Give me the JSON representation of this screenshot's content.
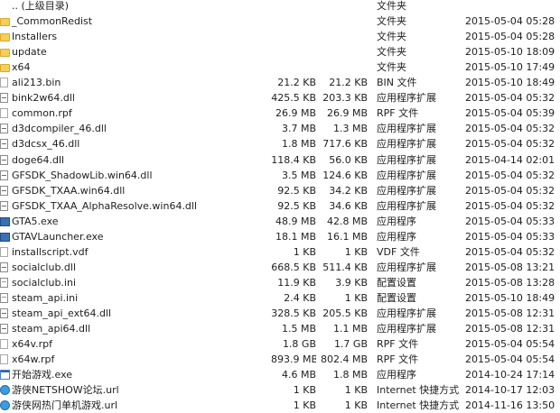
{
  "rows": [
    {
      "icon": "parent-folder-icon",
      "name": ".. (上级目录)",
      "size": "",
      "packed": "",
      "type": "文件夹",
      "modified": ""
    },
    {
      "icon": "folder-icon",
      "name": "_CommonRedist",
      "size": "",
      "packed": "",
      "type": "文件夹",
      "modified": "2015-05-04 05:28"
    },
    {
      "icon": "folder-icon",
      "name": "Installers",
      "size": "",
      "packed": "",
      "type": "文件夹",
      "modified": "2015-05-04 05:28"
    },
    {
      "icon": "folder-icon",
      "name": "update",
      "size": "",
      "packed": "",
      "type": "文件夹",
      "modified": "2015-05-10 18:09"
    },
    {
      "icon": "folder-icon",
      "name": "x64",
      "size": "",
      "packed": "",
      "type": "文件夹",
      "modified": "2015-05-10 17:49"
    },
    {
      "icon": "file-icon",
      "name": "ali213.bin",
      "size": "21.2 KB",
      "packed": "21.2 KB",
      "type": "BIN 文件",
      "modified": "2015-05-10 18:49"
    },
    {
      "icon": "dll-file-icon",
      "name": "bink2w64.dll",
      "size": "425.5 KB",
      "packed": "203.3 KB",
      "type": "应用程序扩展",
      "modified": "2015-05-04 05:32"
    },
    {
      "icon": "file-icon",
      "name": "common.rpf",
      "size": "26.9 MB",
      "packed": "26.9 MB",
      "type": "RPF 文件",
      "modified": "2015-05-04 05:39"
    },
    {
      "icon": "dll-file-icon",
      "name": "d3dcompiler_46.dll",
      "size": "3.7 MB",
      "packed": "1.3 MB",
      "type": "应用程序扩展",
      "modified": "2015-05-04 05:32"
    },
    {
      "icon": "dll-file-icon",
      "name": "d3dcsx_46.dll",
      "size": "1.8 MB",
      "packed": "717.6 KB",
      "type": "应用程序扩展",
      "modified": "2015-05-04 05:32"
    },
    {
      "icon": "dll-file-icon",
      "name": "doge64.dll",
      "size": "118.4 KB",
      "packed": "56.0 KB",
      "type": "应用程序扩展",
      "modified": "2015-04-14 02:01"
    },
    {
      "icon": "dll-file-icon",
      "name": "GFSDK_ShadowLib.win64.dll",
      "size": "3.5 MB",
      "packed": "124.6 KB",
      "type": "应用程序扩展",
      "modified": "2015-05-04 05:32"
    },
    {
      "icon": "dll-file-icon",
      "name": "GFSDK_TXAA.win64.dll",
      "size": "92.5 KB",
      "packed": "34.2 KB",
      "type": "应用程序扩展",
      "modified": "2015-05-04 05:32"
    },
    {
      "icon": "dll-file-icon",
      "name": "GFSDK_TXAA_AlphaResolve.win64.dll",
      "size": "92.5 KB",
      "packed": "34.6 KB",
      "type": "应用程序扩展",
      "modified": "2015-05-04 05:32"
    },
    {
      "icon": "exe-icon",
      "name": "GTA5.exe",
      "size": "48.9 MB",
      "packed": "42.8 MB",
      "type": "应用程序",
      "modified": "2015-05-04 05:33"
    },
    {
      "icon": "exe-icon",
      "name": "GTAVLauncher.exe",
      "size": "18.1 MB",
      "packed": "16.1 MB",
      "type": "应用程序",
      "modified": "2015-05-04 05:33"
    },
    {
      "icon": "file-icon",
      "name": "installscript.vdf",
      "size": "1 KB",
      "packed": "1 KB",
      "type": "VDF 文件",
      "modified": "2015-05-04 05:32"
    },
    {
      "icon": "dll-file-icon",
      "name": "socialclub.dll",
      "size": "668.5 KB",
      "packed": "511.4 KB",
      "type": "应用程序扩展",
      "modified": "2015-05-08 13:21"
    },
    {
      "icon": "ini-file-icon",
      "name": "socialclub.ini",
      "size": "11.9 KB",
      "packed": "3.9 KB",
      "type": "配置设置",
      "modified": "2015-05-08 13:28"
    },
    {
      "icon": "ini-file-icon",
      "name": "steam_api.ini",
      "size": "2.4 KB",
      "packed": "1 KB",
      "type": "配置设置",
      "modified": "2015-05-10 18:49"
    },
    {
      "icon": "dll-file-icon",
      "name": "steam_api_ext64.dll",
      "size": "328.5 KB",
      "packed": "205.5 KB",
      "type": "应用程序扩展",
      "modified": "2015-05-08 12:31"
    },
    {
      "icon": "dll-file-icon",
      "name": "steam_api64.dll",
      "size": "1.5 MB",
      "packed": "1.1 MB",
      "type": "应用程序扩展",
      "modified": "2015-05-08 12:31"
    },
    {
      "icon": "file-icon",
      "name": "x64v.rpf",
      "size": "1.8 GB",
      "packed": "1.7 GB",
      "type": "RPF 文件",
      "modified": "2015-05-04 05:54"
    },
    {
      "icon": "file-icon",
      "name": "x64w.rpf",
      "size": "893.9 MB",
      "packed": "802.4 MB",
      "type": "RPF 文件",
      "modified": "2015-05-04 05:54"
    },
    {
      "icon": "app-icon",
      "name": "开始游戏.exe",
      "size": "4.6 MB",
      "packed": "1.8 MB",
      "type": "应用程序",
      "modified": "2014-10-24 17:14"
    },
    {
      "icon": "url-icon",
      "name": "游侠NETSHOW论坛.url",
      "size": "1 KB",
      "packed": "1 KB",
      "type": "Internet 快捷方式",
      "modified": "2014-10-17 12:03"
    },
    {
      "icon": "url-icon",
      "name": "游侠网热门单机游戏.url",
      "size": "1 KB",
      "packed": "1 KB",
      "type": "Internet 快捷方式",
      "modified": "2014-11-16 13:50"
    }
  ]
}
